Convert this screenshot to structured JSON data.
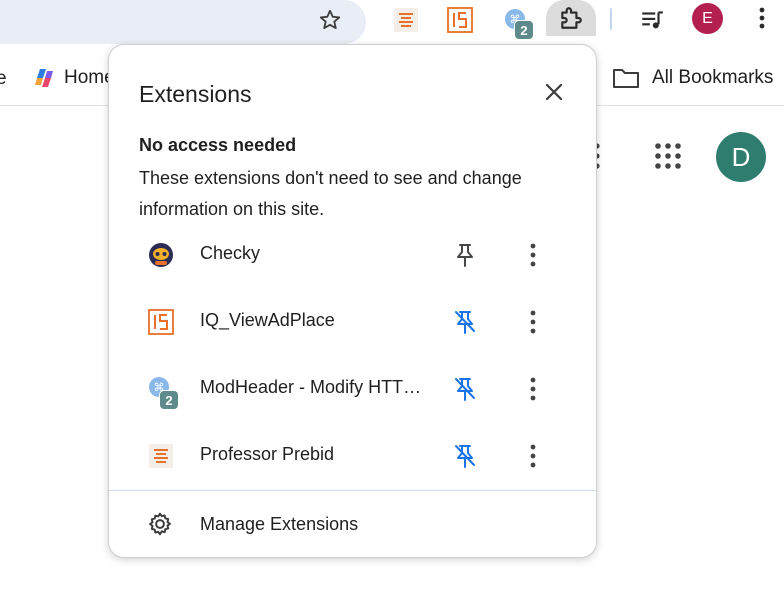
{
  "toolbar": {
    "account_initial": "E",
    "mod_header_badge": "2"
  },
  "bookmarks_bar": {
    "left_fragment": "e",
    "home_label": "Home",
    "all_bookmarks_label": "All Bookmarks"
  },
  "page": {
    "profile_initial": "D"
  },
  "popup": {
    "title": "Extensions",
    "section_heading": "No access needed",
    "section_description": "These extensions don't need to see and change information on this site.",
    "extensions": [
      {
        "name": "Checky",
        "icon": "checky-robot-icon",
        "pinned": true
      },
      {
        "name": "IQ_ViewAdPlace",
        "icon": "iq-viewadplace-icon",
        "pinned": false
      },
      {
        "name": "ModHeader - Modify HTTP headers",
        "icon": "modheader-icon",
        "pinned": false,
        "badge": "2"
      },
      {
        "name": "Professor Prebid",
        "icon": "professor-prebid-icon",
        "pinned": false
      }
    ],
    "manage_label": "Manage Extensions"
  },
  "colors": {
    "accent_blue": "#1a73e8",
    "unpinned_icon": "#1a73e8",
    "pinned_icon": "#444746",
    "account_avatar": "#b3204f",
    "profile_avatar": "#2e7d6e"
  }
}
